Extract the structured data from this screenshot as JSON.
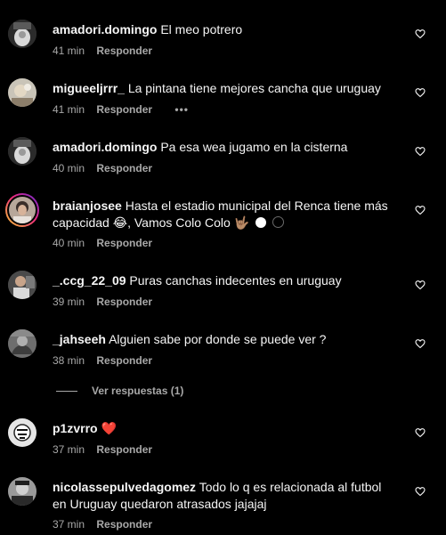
{
  "comments": [
    {
      "username": "amadori.domingo",
      "text": "El meo potrero",
      "time": "41 min",
      "reply": "Responder"
    },
    {
      "username": "migueeljrrr_",
      "text": "La pintana tiene mejores cancha que uruguay",
      "time": "41 min",
      "reply": "Responder",
      "more": "•••"
    },
    {
      "username": "amadori.domingo",
      "text": "Pa esa wea jugamo en la cisterna",
      "time": "40 min",
      "reply": "Responder"
    },
    {
      "username": "braianjosee",
      "text": "Hasta el estadio municipal del Renca tiene más capacidad 😂, Vamos Colo Colo 🤟🏽",
      "time": "40 min",
      "reply": "Responder"
    },
    {
      "username": "_.ccg_22_09",
      "text": "Puras canchas indecentes en uruguay",
      "time": "39 min",
      "reply": "Responder"
    },
    {
      "username": "_jahseeh",
      "text": "Alguien sabe por donde se puede ver ?",
      "time": "38 min",
      "reply": "Responder"
    },
    {
      "username": "p1zvrro",
      "text": "❤️",
      "time": "37 min",
      "reply": "Responder"
    },
    {
      "username": "nicolassepulvedagomez",
      "text": "Todo lo q es relacionada al futbol en Uruguay quedaron atrasados jajajaj",
      "time": "37 min",
      "reply": "Responder"
    }
  ],
  "view_replies": "Ver respuestas (1)",
  "colors": {
    "background": "#000000",
    "text": "#f5f5f5",
    "muted": "#a8a8a8",
    "heart_red": "#ff3040"
  },
  "icons": {
    "like": "heart-outline-icon",
    "more": "more-options-icon"
  }
}
